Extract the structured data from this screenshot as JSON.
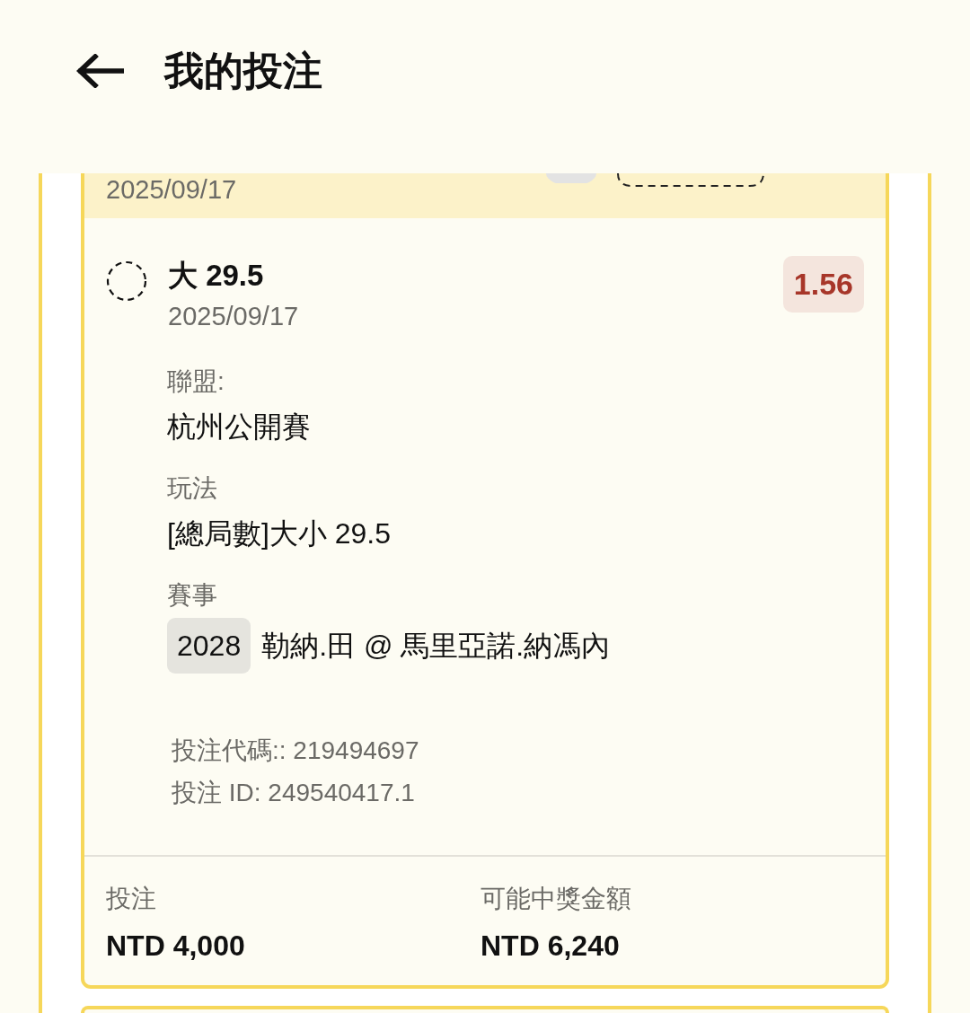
{
  "header": {
    "title": "我的投注"
  },
  "bets": [
    {
      "band_date": "2025/09/17",
      "selection": "大 29.5",
      "date": "2025/09/17",
      "odds": "1.56",
      "details": [
        {
          "label": "聯盟:",
          "value": "杭州公開賽"
        },
        {
          "label": "玩法",
          "value": "[總局數]大小 29.5"
        },
        {
          "label": "賽事",
          "tag": "2028",
          "value": "勒納.田 @ 馬里亞諾.納馮內"
        }
      ],
      "bet_code": "投注代碼:: 219494697",
      "bet_id": "投注 ID: 249540417.1",
      "summary": [
        {
          "label": "投注",
          "value": "NTD 4,000"
        },
        {
          "label": "可能中獎金額",
          "value": "NTD 6,240"
        }
      ]
    }
  ]
}
